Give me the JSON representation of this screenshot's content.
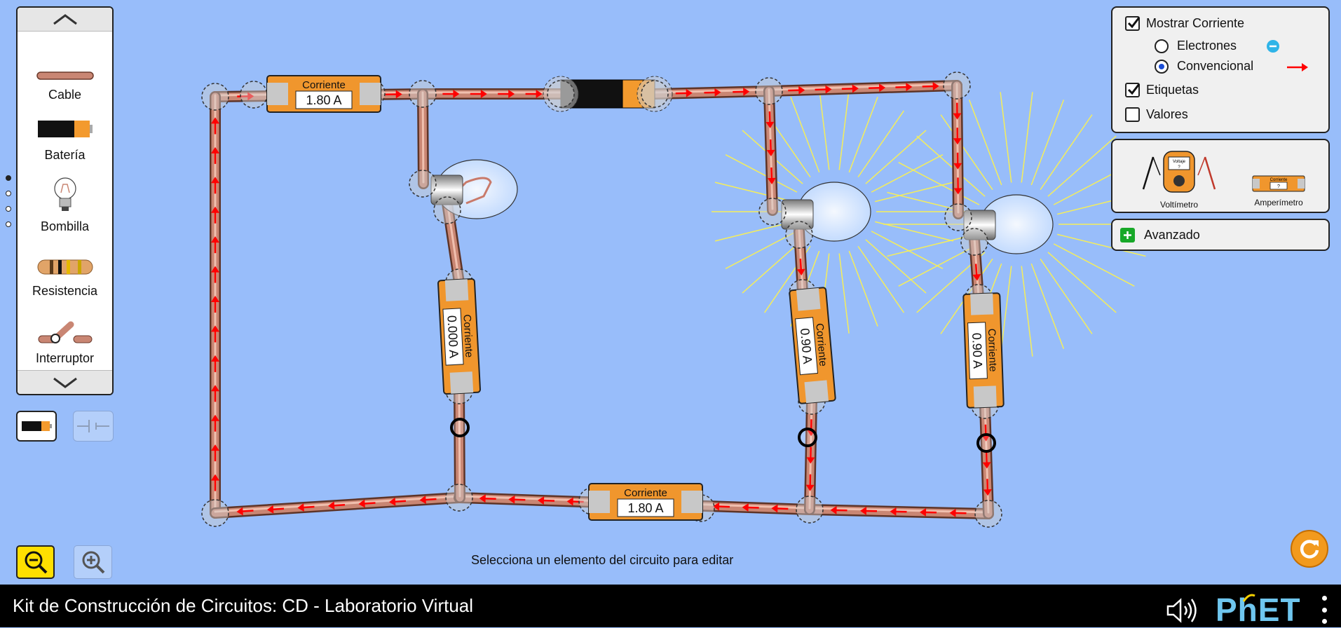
{
  "toolbox": {
    "items": [
      {
        "label": "Cable"
      },
      {
        "label": "Batería"
      },
      {
        "label": "Bombilla"
      },
      {
        "label": "Resistencia"
      },
      {
        "label": "Interruptor"
      }
    ]
  },
  "circuit": {
    "ammeter_top": {
      "title": "Corriente",
      "value": "1.80 A"
    },
    "ammeter_bottom": {
      "title": "Corriente",
      "value": "1.80 A"
    },
    "ammeter_left": {
      "title": "Corriente",
      "value": "0.000 A"
    },
    "ammeter_mid": {
      "title": "Corriente",
      "value": "0.90 A"
    },
    "ammeter_right": {
      "title": "Corriente",
      "value": "0.90 A"
    }
  },
  "display_panel": {
    "show_current": {
      "label": "Mostrar Corriente",
      "checked": true
    },
    "electrons": {
      "label": "Electrones",
      "selected": false
    },
    "conventional": {
      "label": "Convencional",
      "selected": true
    },
    "labels": {
      "label": "Etiquetas",
      "checked": true
    },
    "values": {
      "label": "Valores",
      "checked": false
    }
  },
  "sensors_panel": {
    "voltmeter": {
      "label": "Voltímetro",
      "screen_text": "Voltaje",
      "screen_value": "?"
    },
    "ammeter": {
      "label": "Amperímetro",
      "screen_text": "Corriente",
      "screen_value": "?"
    }
  },
  "advanced": {
    "label": "Avanzado"
  },
  "status": {
    "hint": "Selecciona un elemento del circuito para editar"
  },
  "footer": {
    "title": "Kit de Construcción de Circuitos: CD - Laboratorio Virtual",
    "logo": "PhET"
  },
  "colors": {
    "background": "#98bdfa",
    "wire": "#b87a65",
    "arrow": "#ff0000",
    "meter": "#f0962d",
    "zoom_active": "#ffe000"
  }
}
